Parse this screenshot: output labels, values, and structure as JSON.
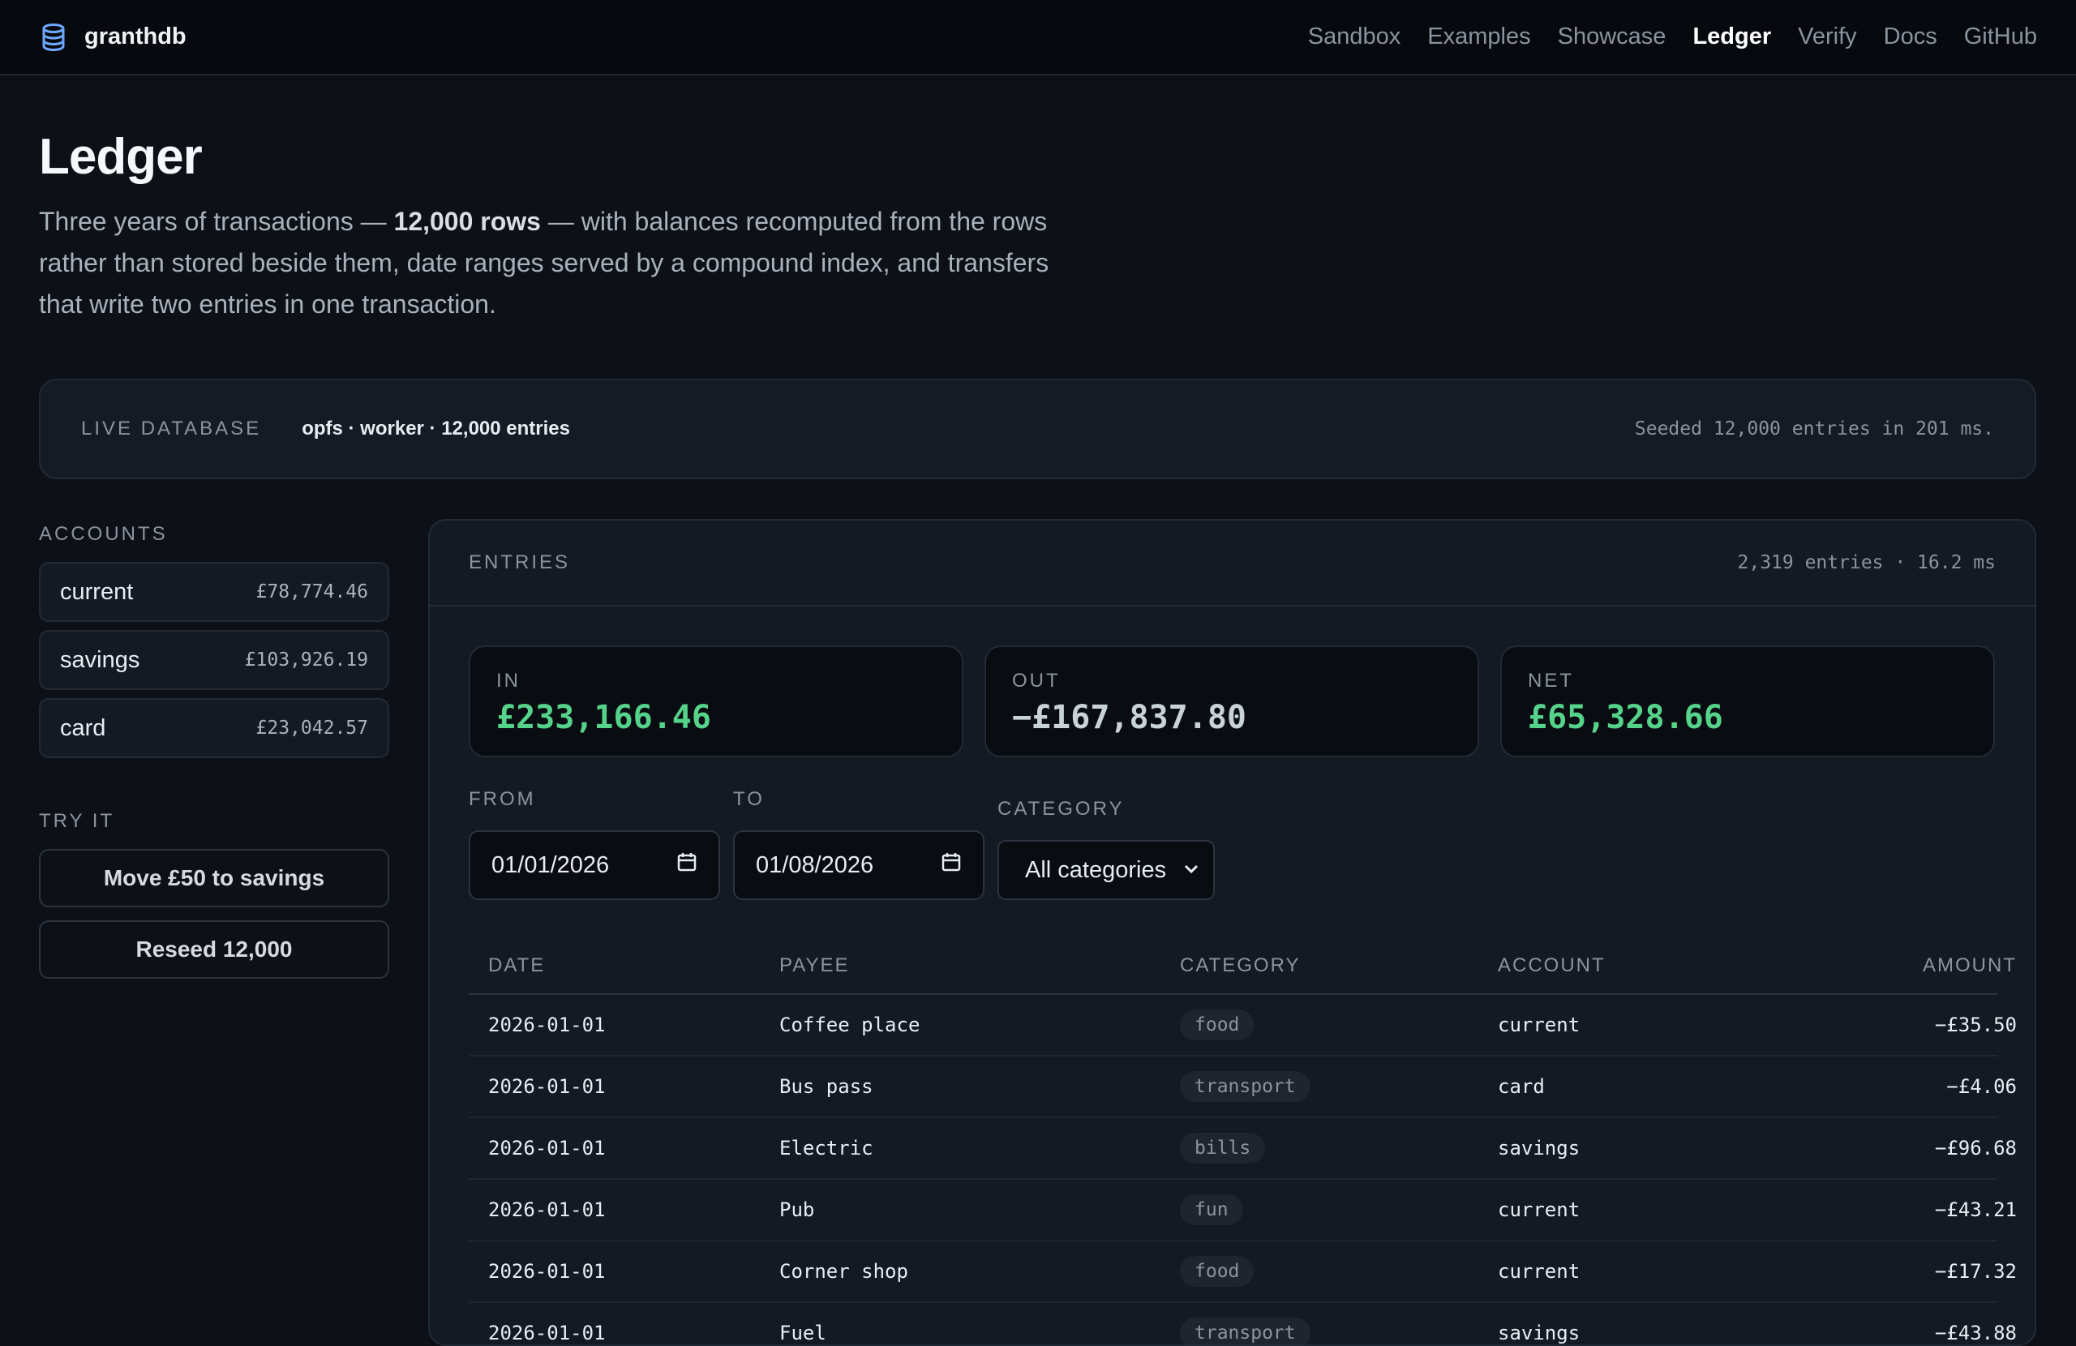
{
  "app": {
    "name": "granthdb",
    "icon": "database-icon"
  },
  "nav": [
    {
      "label": "Sandbox",
      "active": false
    },
    {
      "label": "Examples",
      "active": false
    },
    {
      "label": "Showcase",
      "active": false
    },
    {
      "label": "Ledger",
      "active": true
    },
    {
      "label": "Verify",
      "active": false
    },
    {
      "label": "Docs",
      "active": false
    },
    {
      "label": "GitHub",
      "active": false
    }
  ],
  "page": {
    "title": "Ledger",
    "intro_pre": "Three years of transactions — ",
    "intro_bold": "12,000 rows",
    "intro_post": " — with balances recomputed from the rows rather than stored beside them, date ranges served by a compound index, and transfers that write two entries in one transaction."
  },
  "live": {
    "label": "LIVE DATABASE",
    "meta": "opfs · worker · 12,000 entries",
    "seed": "Seeded 12,000 entries in 201 ms."
  },
  "sidebar": {
    "accounts_label": "ACCOUNTS",
    "accounts": [
      {
        "name": "current",
        "balance": "£78,774.46"
      },
      {
        "name": "savings",
        "balance": "£103,926.19"
      },
      {
        "name": "card",
        "balance": "£23,042.57"
      }
    ],
    "try_label": "TRY IT",
    "move_button": "Move £50 to savings",
    "reseed_button": "Reseed 12,000"
  },
  "entries": {
    "label": "ENTRIES",
    "stat": "2,319 entries · 16.2 ms",
    "in_label": "IN",
    "in_value": "£233,166.46",
    "out_label": "OUT",
    "out_value": "−£167,837.80",
    "net_label": "NET",
    "net_value": "£65,328.66",
    "from_label": "FROM",
    "from_value": "01/01/2026",
    "to_label": "TO",
    "to_value": "01/08/2026",
    "category_label": "CATEGORY",
    "category_value": "All categories",
    "columns": [
      "DATE",
      "PAYEE",
      "CATEGORY",
      "ACCOUNT",
      "AMOUNT"
    ],
    "rows": [
      {
        "date": "2026-01-01",
        "payee": "Coffee place",
        "category": "food",
        "account": "current",
        "amount": "−£35.50"
      },
      {
        "date": "2026-01-01",
        "payee": "Bus pass",
        "category": "transport",
        "account": "card",
        "amount": "−£4.06"
      },
      {
        "date": "2026-01-01",
        "payee": "Electric",
        "category": "bills",
        "account": "savings",
        "amount": "−£96.68"
      },
      {
        "date": "2026-01-01",
        "payee": "Pub",
        "category": "fun",
        "account": "current",
        "amount": "−£43.21"
      },
      {
        "date": "2026-01-01",
        "payee": "Corner shop",
        "category": "food",
        "account": "current",
        "amount": "−£17.32"
      },
      {
        "date": "2026-01-01",
        "payee": "Fuel",
        "category": "transport",
        "account": "savings",
        "amount": "−£43.88"
      }
    ]
  },
  "colors": {
    "positive": "#56d38a",
    "background": "#0d1117",
    "accent_icon": "#6ea8fe"
  }
}
